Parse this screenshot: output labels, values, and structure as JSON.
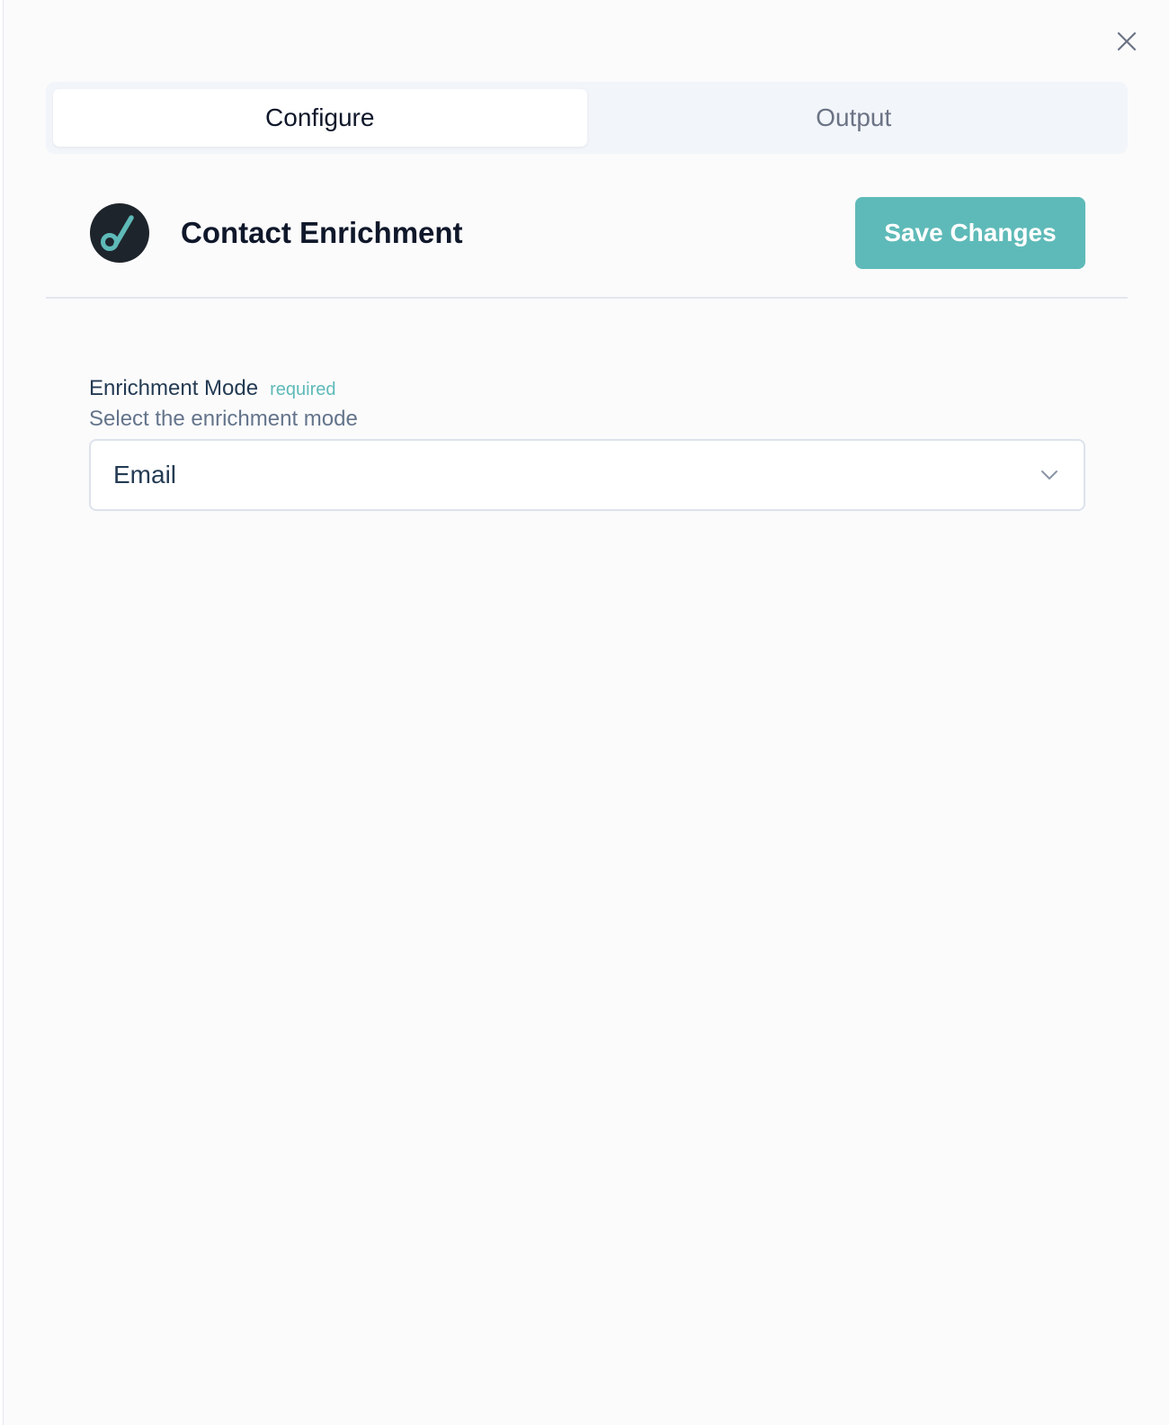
{
  "tabs": [
    {
      "label": "Configure",
      "active": true
    },
    {
      "label": "Output",
      "active": false
    }
  ],
  "header": {
    "title": "Contact Enrichment",
    "logo_icon": "contact-enrichment-logo-icon",
    "save_label": "Save Changes"
  },
  "form": {
    "enrichment_mode": {
      "label": "Enrichment Mode",
      "required_tag": "required",
      "help_text": "Select the enrichment mode",
      "selected_value": "Email"
    }
  },
  "icons": {
    "close": "close-icon",
    "dropdown": "chevron-down-icon"
  },
  "colors": {
    "accent": "#5ebab8",
    "logo_bg": "#1e242b",
    "text_primary": "#0f172a",
    "text_muted": "#64748b"
  }
}
